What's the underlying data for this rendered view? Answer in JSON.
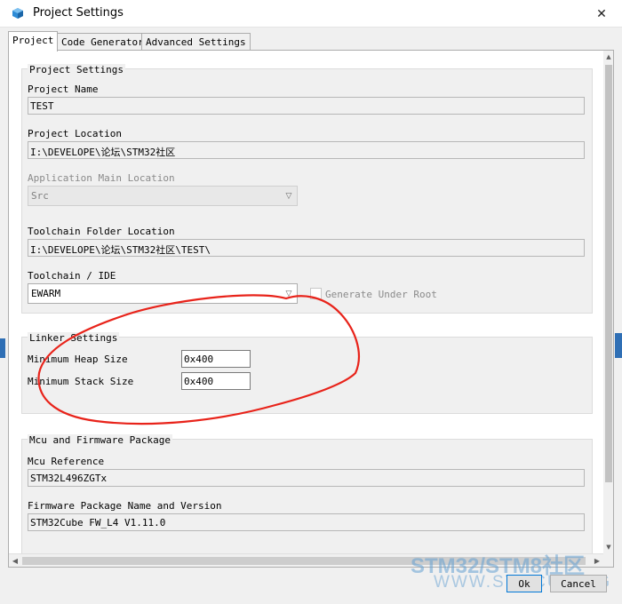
{
  "window": {
    "title": "Project Settings",
    "close_glyph": "✕"
  },
  "tabs": [
    {
      "label": "Project",
      "active": true
    },
    {
      "label": "Code Generator",
      "active": false
    },
    {
      "label": "Advanced Settings",
      "active": false
    }
  ],
  "project_settings": {
    "group_title": "Project Settings",
    "project_name_label": "Project Name",
    "project_name_value": "TEST",
    "project_location_label": "Project Location",
    "project_location_value": "I:\\DEVELOPE\\论坛\\STM32社区",
    "app_main_location_label": "Application Main Location",
    "app_main_location_value": "Src",
    "toolchain_folder_label": "Toolchain Folder Location",
    "toolchain_folder_value": "I:\\DEVELOPE\\论坛\\STM32社区\\TEST\\",
    "toolchain_ide_label": "Toolchain / IDE",
    "toolchain_ide_value": "EWARM",
    "generate_under_root_label": "Generate Under Root"
  },
  "linker_settings": {
    "group_title": "Linker Settings",
    "min_heap_label": "Minimum Heap Size",
    "min_heap_value": "0x400",
    "min_stack_label": "Minimum Stack Size",
    "min_stack_value": "0x400"
  },
  "mcu_firmware": {
    "group_title": "Mcu and Firmware Package",
    "mcu_reference_label": "Mcu Reference",
    "mcu_reference_value": "STM32L496ZGTx",
    "firmware_label": "Firmware Package Name and Version",
    "firmware_value": "STM32Cube FW_L4 V1.11.0"
  },
  "buttons": {
    "ok": "Ok",
    "cancel": "Cancel"
  },
  "watermark": {
    "text": "STM32/STM8社区",
    "url": "WWW.STMCU.ORG"
  },
  "colors": {
    "annotation": "#e8231a",
    "accent": "#0078d7"
  }
}
